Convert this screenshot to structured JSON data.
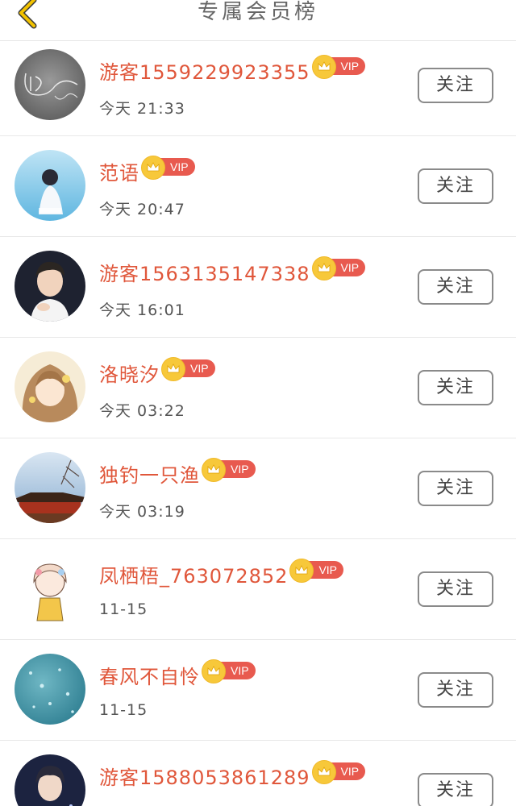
{
  "header": {
    "title": "专属会员榜",
    "back_icon": "chevron-left-icon",
    "back_color": "#f2c200"
  },
  "colors": {
    "name": "#e0573b",
    "vip_badge": "#e85a4f",
    "crown": "#f7c83a"
  },
  "members": [
    {
      "name": "游客1559229923355",
      "vip": "VIP",
      "time": "今天 21:33",
      "follow": "关注"
    },
    {
      "name": "范语",
      "vip": "VIP",
      "time": "今天 20:47",
      "follow": "关注"
    },
    {
      "name": "游客1563135147338",
      "vip": "VIP",
      "time": "今天 16:01",
      "follow": "关注"
    },
    {
      "name": "洛晓汐",
      "vip": "VIP",
      "time": "今天 03:22",
      "follow": "关注"
    },
    {
      "name": "独钓一只渔",
      "vip": "VIP",
      "time": "今天 03:19",
      "follow": "关注"
    },
    {
      "name": "凤栖梧_763072852",
      "vip": "VIP",
      "time": "11-15",
      "follow": "关注"
    },
    {
      "name": "春风不自怜",
      "vip": "VIP",
      "time": "11-15",
      "follow": "关注"
    },
    {
      "name": "游客1588053861289",
      "vip": "VIP",
      "time": "",
      "follow": "关注"
    }
  ]
}
